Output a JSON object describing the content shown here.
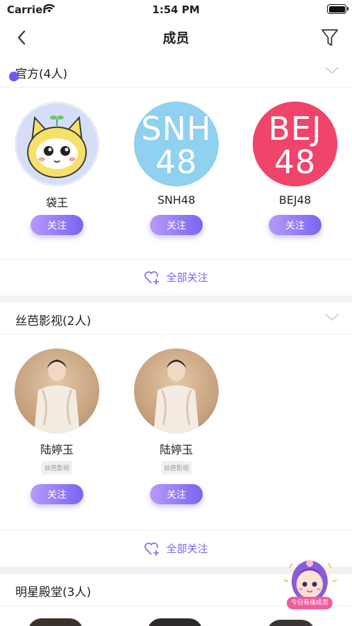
{
  "status": {
    "carrier": "Carrier",
    "time": "1:54 PM"
  },
  "nav": {
    "title": "成员"
  },
  "sections": [
    {
      "title": "官方(4人)",
      "members": [
        {
          "name": "袋王",
          "follow": "关注"
        },
        {
          "name": "SNH48",
          "logo_top": "SNH",
          "logo_bottom": "48",
          "follow": "关注"
        },
        {
          "name": "BEJ48",
          "logo_top": "BEJ",
          "logo_bottom": "48",
          "follow": "关注"
        }
      ],
      "follow_all": "全部关注"
    },
    {
      "title": "丝芭影视(2人)",
      "members": [
        {
          "name": "陆婷玉",
          "tag": "丝芭影视",
          "follow": "关注"
        },
        {
          "name": "陆婷玉",
          "tag": "丝芭影视",
          "follow": "关注"
        }
      ],
      "follow_all": "全部关注"
    },
    {
      "title": "明星殿堂(3人)"
    }
  ],
  "mascot": {
    "badge_text": "今日有缘成员"
  },
  "colors": {
    "accent": "#7a64f1",
    "snh": "#8fd1ef",
    "bej": "#f0446a"
  }
}
